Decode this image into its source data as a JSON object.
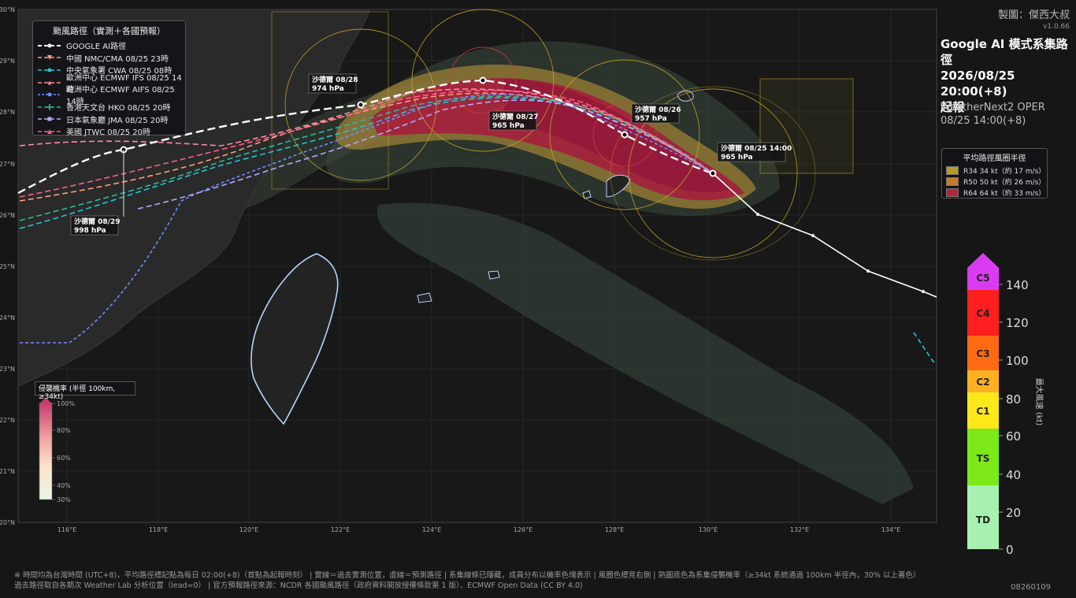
{
  "credit": "製圖：傑西大叔",
  "version": "v1.0.66",
  "heading_lines": [
    "Google AI 模式系集路徑",
    "2026/08/25 20:00(+8)",
    "起報"
  ],
  "sub_lines": [
    "WeatherNext2 OPER",
    "08/25 14:00(+8)"
  ],
  "legend": {
    "title": "颱風路徑（實測＋各國預報）",
    "items": [
      {
        "label": "GOOGLE AI路徑",
        "color": "#ffffff",
        "marker": "circle"
      },
      {
        "label": "中國 NMC/CMA  08/25 23時",
        "color": "#ff9e7a",
        "marker": "triangle-down"
      },
      {
        "label": "中央氣象署 CWA  08/25 08時",
        "color": "#1fc6d4",
        "marker": "circle"
      },
      {
        "label": "歐洲中心 ECMWF IFS  08/25 14時",
        "color": "#ff8aa6",
        "marker": "star"
      },
      {
        "label": "歐洲中心 ECMWF AIFS  08/25 14時",
        "color": "#6f8cff",
        "marker": "circle"
      },
      {
        "label": "香港天文台 HKO  08/25 20時",
        "color": "#2fb89a",
        "marker": "plus"
      },
      {
        "label": "日本氣象廳 JMA  08/25 20時",
        "color": "#b7a6ff",
        "marker": "square"
      },
      {
        "label": "美國 JTWC  08/25 20時",
        "color": "#ff5f86",
        "marker": "triangle-up"
      }
    ]
  },
  "wind_radii": {
    "title": "平均路徑風圈半徑",
    "items": [
      {
        "label": "R34   34 kt（約 17 m/s）",
        "color": "#b39a2a"
      },
      {
        "label": "R50   50 kt（約 26 m/s）",
        "color": "#c57a2c"
      },
      {
        "label": "R64   64 kt（約 33 m/s）",
        "color": "#b0283a"
      }
    ]
  },
  "prob_title": "侵襲機率 (半徑 100km, ≥34kt)",
  "prob_ticks": [
    "100%",
    "80%",
    "60%",
    "40%",
    "30%"
  ],
  "intensity": {
    "axis_label": "最大風速 (kt)",
    "categories": [
      {
        "name": "C5",
        "color": "#d93cf0"
      },
      {
        "name": "C4",
        "color": "#ff1f1f"
      },
      {
        "name": "C3",
        "color": "#ff6a12"
      },
      {
        "name": "C2",
        "color": "#ffb020"
      },
      {
        "name": "C1",
        "color": "#ffe81a"
      },
      {
        "name": "TS",
        "color": "#7de81a"
      },
      {
        "name": "TD",
        "color": "#a6f0b0"
      }
    ],
    "ticks": [
      "140",
      "120",
      "100",
      "80",
      "60",
      "40",
      "20",
      "0"
    ]
  },
  "lat_ticks": [
    "30°N",
    "29°N",
    "28°N",
    "27°N",
    "26°N",
    "25°N",
    "24°N",
    "23°N",
    "22°N",
    "21°N",
    "20°N"
  ],
  "lon_ticks": [
    "116°E",
    "118°E",
    "120°E",
    "122°E",
    "124°E",
    "126°E",
    "128°E",
    "130°E",
    "132°E",
    "134°E"
  ],
  "storm_labels": [
    {
      "name": "沙德爾 08/25 14:00",
      "pressure": "965 hPa"
    },
    {
      "name": "沙德爾 08/26",
      "pressure": "957 hPa"
    },
    {
      "name": "沙德爾 08/27",
      "pressure": "965 hPa"
    },
    {
      "name": "沙德爾 08/28",
      "pressure": "974 hPa"
    },
    {
      "name": "沙德爾 08/29",
      "pressure": "998 hPa"
    }
  ],
  "footer_lines": [
    "※ 時間均為台灣時間 (UTC+8)，平均路徑標記點為每日 02:00(+8)（首點為起報時刻）   |   實線＝過去實測位置，虛線＝預測路徑   |   系集線條已隱藏，成員分布以機率色塊表示   |   風圈色標見右側   |   熱圖底色為系集侵襲機率（≥34kt 系統通過 100km 半徑內，30% 以上著色）",
    "過去路徑取自各期次 Weather Lab 分析位置（lead=0）   |   官方預報路徑來源：NCDR 各國颱風路徑（政府資料開放授權條款第 1 版）、ECMWF Open Data (CC BY 4.0)"
  ],
  "code": "08260109"
}
